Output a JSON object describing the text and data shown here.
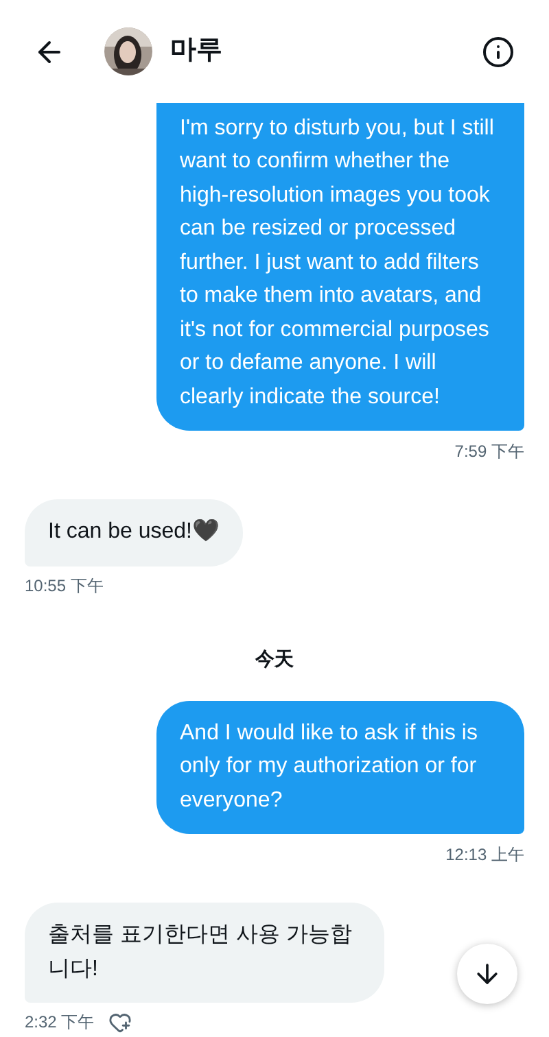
{
  "header": {
    "name": "마루"
  },
  "messages": [
    {
      "kind": "sent",
      "text": "I'm sorry to disturb you, but I still want to confirm whether the high-resolution images you took can be resized or processed further. I just want to add filters to make them into avatars, and it's not for commercial purposes or to defame anyone. I will clearly indicate the source!",
      "time": "7:59 下午"
    },
    {
      "kind": "received",
      "text": "It can be used!🖤",
      "time": "10:55 下午"
    },
    {
      "kind": "divider",
      "text": "今天"
    },
    {
      "kind": "sent",
      "text": "And I would like to ask if this is only for my authorization or for everyone?",
      "time": "12:13 上午"
    },
    {
      "kind": "received",
      "text": "출처를 표기한다면 사용 가능합니다!",
      "time": "2:32 下午"
    }
  ]
}
